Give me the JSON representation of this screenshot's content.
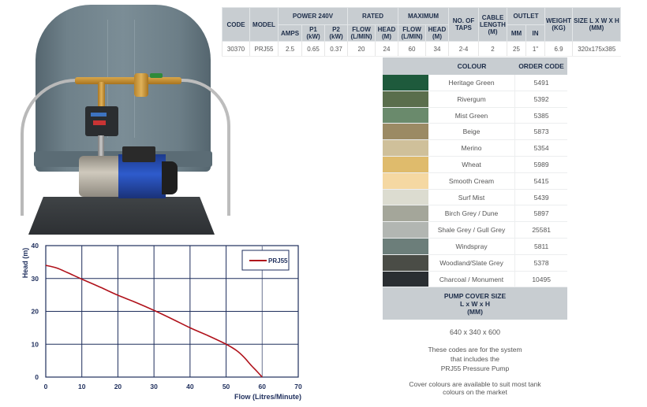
{
  "product_image": {
    "description": "Pressure pump system with grey pump cover",
    "icon": "pump-photo"
  },
  "spec_table": {
    "headers_top": [
      "CODE",
      "MODEL",
      "POWER 240V",
      "RATED",
      "MAXIMUM",
      "NO. OF TAPS",
      "CABLE LENGTH (M)",
      "OUTLET",
      "WEIGHT (KG)",
      "SIZE L X W X H (MM)"
    ],
    "headers_sub": [
      "AMPS",
      "P1 (kW)",
      "P2 (kW)",
      "FLOW (L/MIN)",
      "HEAD (M)",
      "FLOW (L/MIN)",
      "HEAD (M)",
      "MM",
      "IN"
    ],
    "row": {
      "code": "30370",
      "model": "PRJ55",
      "amps": "2.5",
      "p1": "0.65",
      "p2": "0.37",
      "rated_flow": "20",
      "rated_head": "24",
      "max_flow": "60",
      "max_head": "34",
      "taps": "2-4",
      "cable": "2",
      "outlet_mm": "25",
      "outlet_in": "1\"",
      "weight": "6.9",
      "size": "320x175x385"
    }
  },
  "colour_table": {
    "header_colour": "COLOUR",
    "header_code": "ORDER CODE",
    "rows": [
      {
        "name": "Heritage Green",
        "code": "5491",
        "swatch": "#1e5a3c"
      },
      {
        "name": "Rivergum",
        "code": "5392",
        "swatch": "#5a6e4c"
      },
      {
        "name": "Mist Green",
        "code": "5385",
        "swatch": "#6a8a6c"
      },
      {
        "name": "Beige",
        "code": "5873",
        "swatch": "#9b8a64"
      },
      {
        "name": "Merino",
        "code": "5354",
        "swatch": "#cfc09a"
      },
      {
        "name": "Wheat",
        "code": "5989",
        "swatch": "#dfbb6c"
      },
      {
        "name": "Smooth Cream",
        "code": "5415",
        "swatch": "#f5d8a2"
      },
      {
        "name": "Surf Mist",
        "code": "5439",
        "swatch": "#dcdcd0"
      },
      {
        "name": "Birch Grey / Dune",
        "code": "5897",
        "swatch": "#a4a69a"
      },
      {
        "name": "Shale Grey / Gull Grey",
        "code": "25581",
        "swatch": "#b2b6b2"
      },
      {
        "name": "Windspray",
        "code": "5811",
        "swatch": "#6c7e7a"
      },
      {
        "name": "Woodland/Slate Grey",
        "code": "5378",
        "swatch": "#4a4c46"
      },
      {
        "name": "Charcoal / Monument",
        "code": "10495",
        "swatch": "#2a2e32"
      }
    ],
    "cover_size_heading": [
      "PUMP COVER SIZE",
      "L x W x H",
      "(MM)"
    ],
    "cover_size_value": "640 x 340 x 600",
    "note_system": [
      "These codes are for the system",
      "that includes the",
      "PRJ55 Pressure Pump"
    ],
    "note_colours": [
      "Cover colours are available to suit most tank",
      "colours on the market"
    ]
  },
  "chart_data": {
    "type": "line",
    "title": "",
    "xlabel": "Flow (Litres/Minute)",
    "ylabel": "Head (m)",
    "xlim": [
      0,
      70
    ],
    "ylim": [
      0,
      40
    ],
    "xticks": [
      0,
      10,
      20,
      30,
      40,
      50,
      60,
      70
    ],
    "yticks": [
      0,
      10,
      20,
      30,
      40
    ],
    "grid": true,
    "legend_position": "top-right",
    "series": [
      {
        "name": "PRJ55",
        "color": "#b0121b",
        "x": [
          0,
          3,
          6,
          10,
          15,
          20,
          25,
          30,
          35,
          40,
          45,
          50,
          53,
          55,
          57,
          58.5,
          60
        ],
        "y": [
          34,
          33.2,
          31.8,
          29.8,
          27.4,
          24.9,
          22.7,
          20.3,
          17.7,
          15,
          12.6,
          10,
          8,
          6,
          3.5,
          1.8,
          0
        ]
      }
    ]
  }
}
